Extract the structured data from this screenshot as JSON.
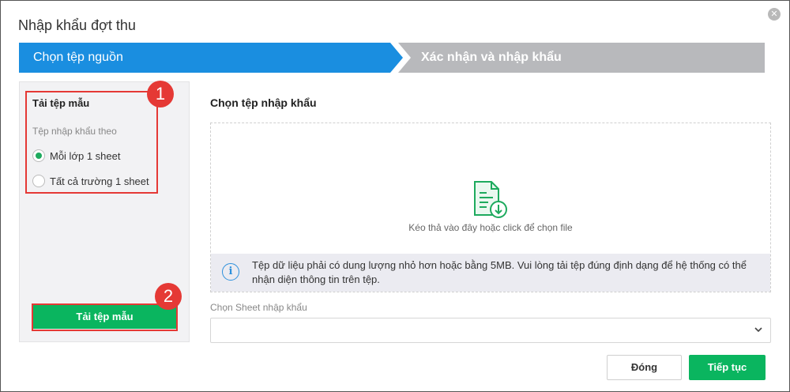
{
  "dialog": {
    "title": "Nhập khẩu đợt thu",
    "close_icon": "close-icon",
    "close_glyph": "✕"
  },
  "steps": [
    {
      "label": "Chọn tệp nguồn",
      "active": true,
      "color": "#1a8ee0"
    },
    {
      "label": "Xác nhận và nhập khẩu",
      "active": false,
      "color": "#b8b9bc"
    }
  ],
  "template_panel": {
    "title": "Tải tệp mẫu",
    "subtitle": "Tệp nhập khẩu theo",
    "options": [
      {
        "label": "Mỗi lớp 1 sheet",
        "checked": true
      },
      {
        "label": "Tất cả trường 1 sheet",
        "checked": false
      }
    ],
    "download_button": "Tải tệp mẫu"
  },
  "annotations": {
    "badge1": "1",
    "badge2": "2",
    "color": "#e53935"
  },
  "upload": {
    "heading": "Chọn tệp nhập khẩu",
    "drop_text": "Kéo thả vào đây hoặc click để chọn file",
    "info_icon": "i",
    "info_text": "Tệp dữ liệu phải có dung lượng nhỏ hơn hoặc bằng 5MB. Vui lòng tải tệp đúng định dạng để hệ thống có thể nhận diện thông tin trên tệp."
  },
  "sheet": {
    "label": "Chọn Sheet nhập khẩu",
    "value": ""
  },
  "footer": {
    "close_button": "Đóng",
    "next_button": "Tiếp tục"
  },
  "colors": {
    "primary_green": "#0ab55f",
    "step_blue": "#1a8ee0",
    "step_gray": "#b8b9bc"
  }
}
